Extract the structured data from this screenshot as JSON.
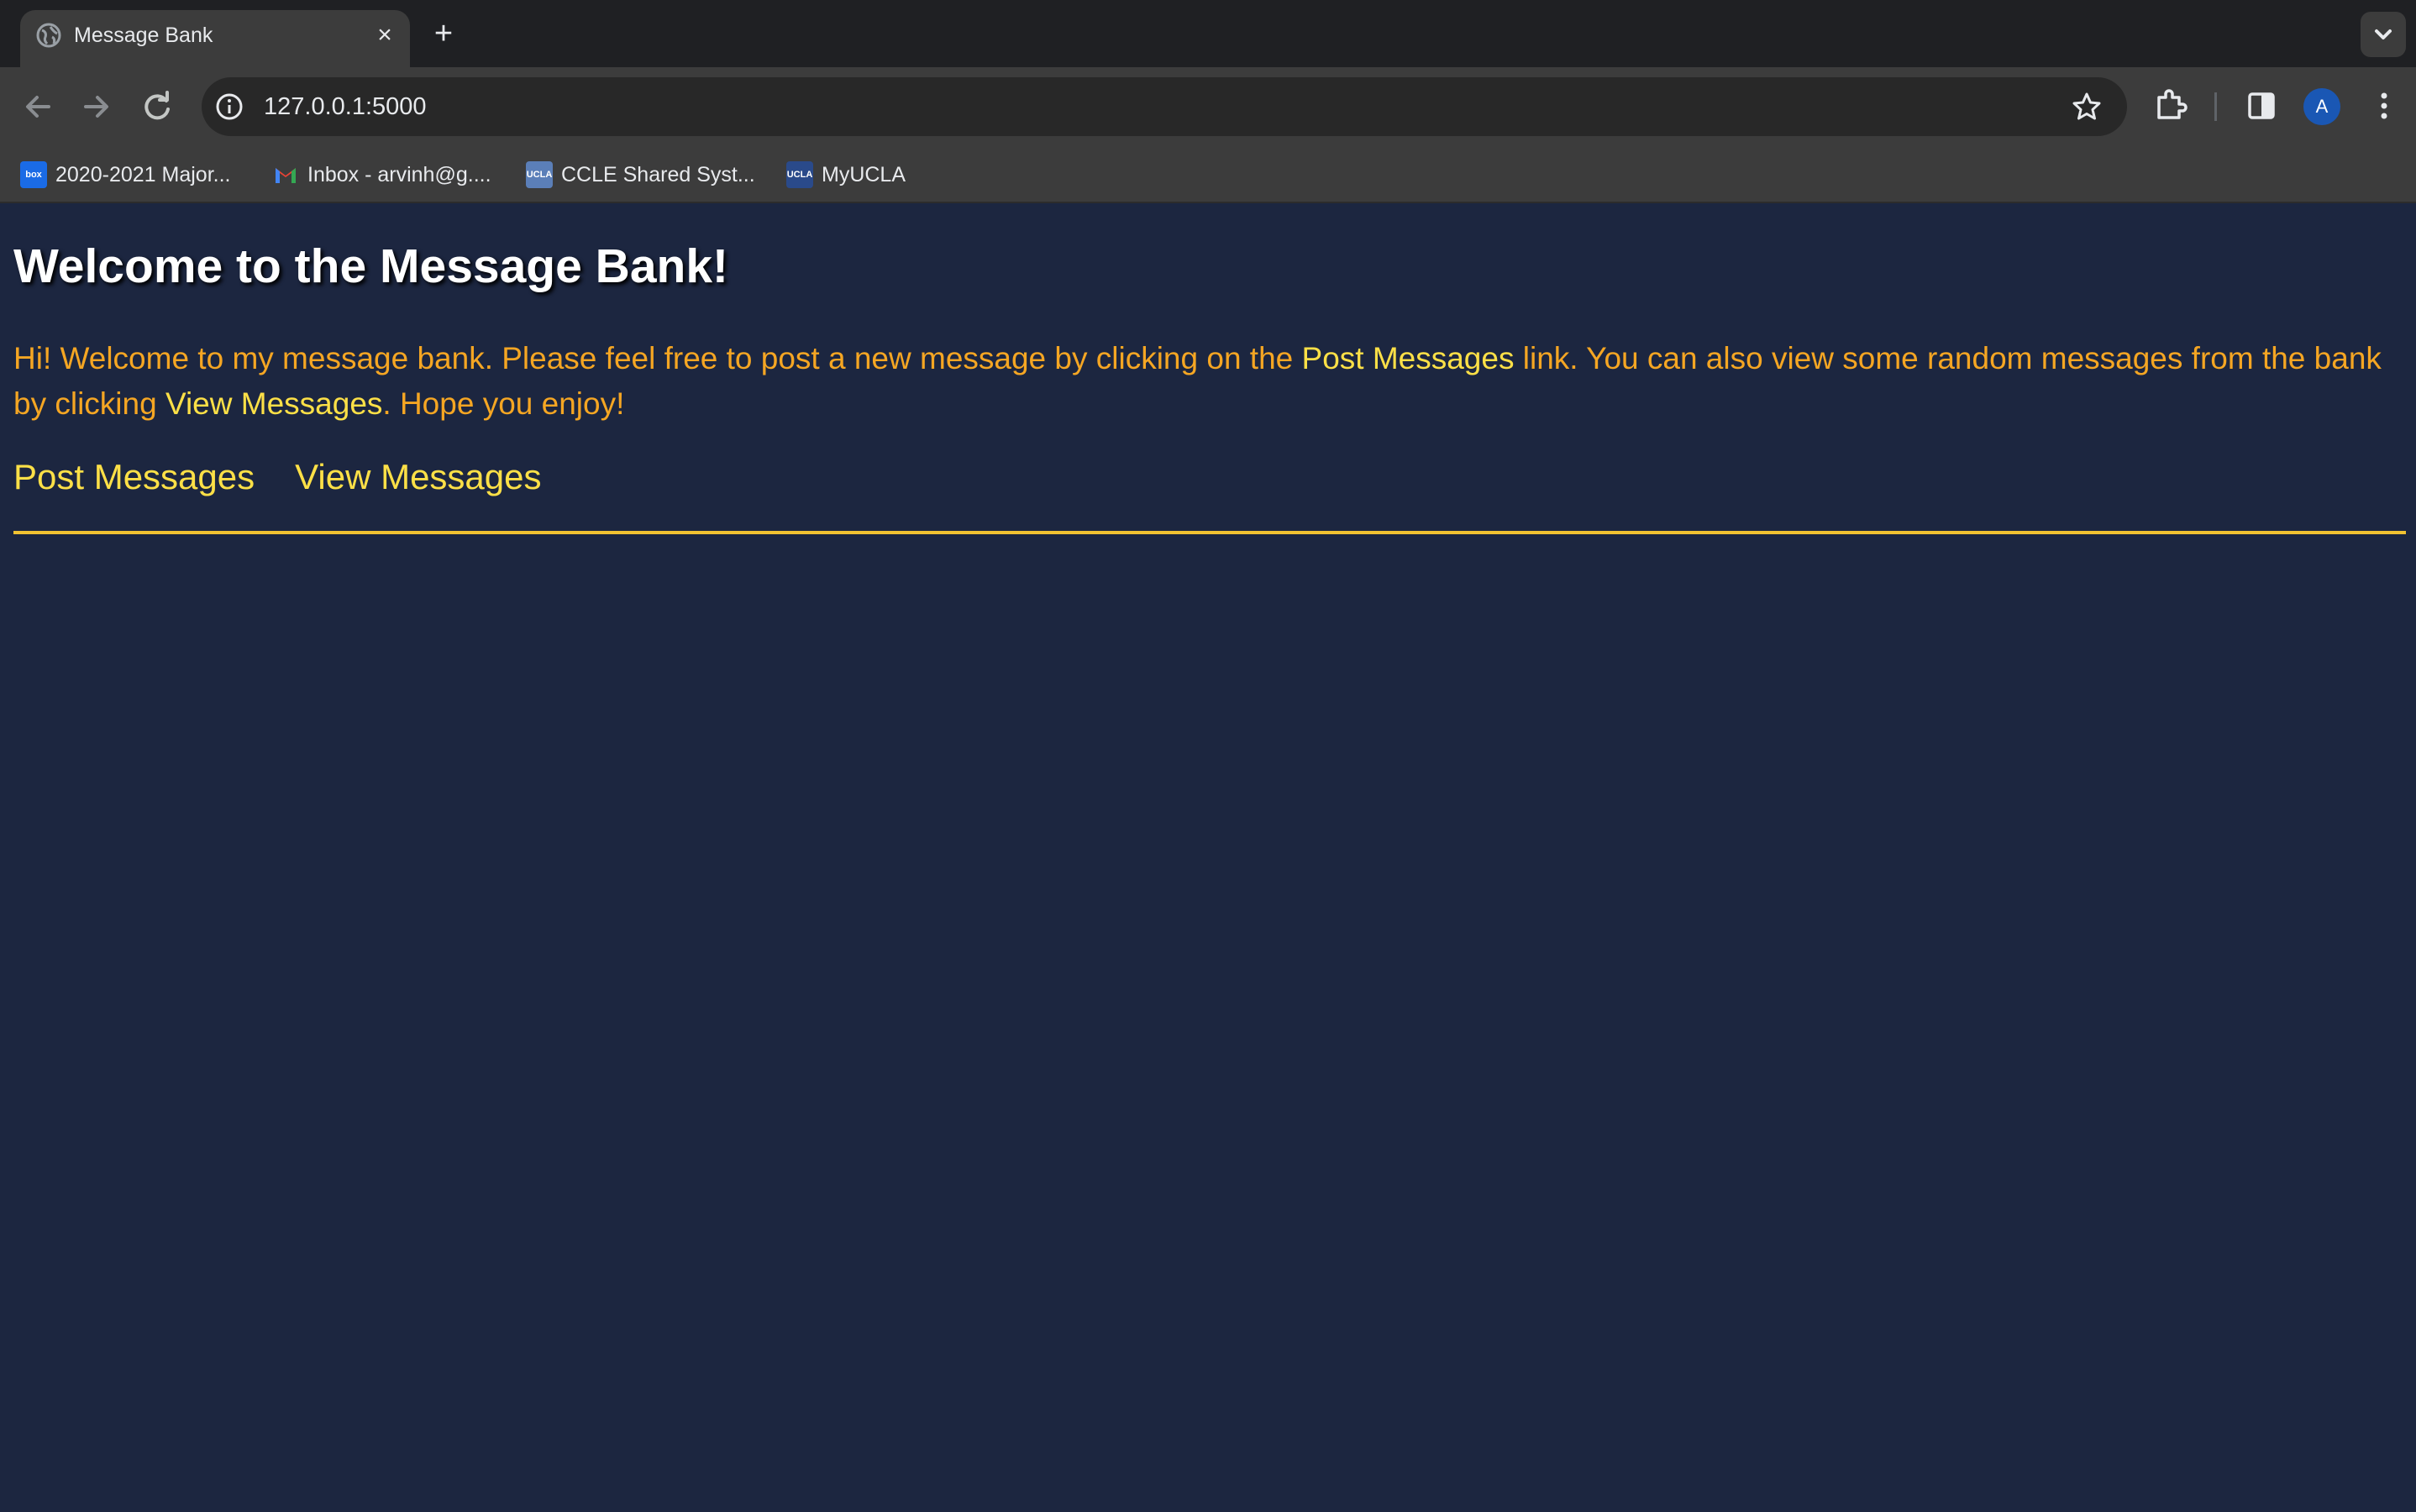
{
  "browser": {
    "tab": {
      "title": "Message Bank",
      "close_label": "×"
    },
    "new_tab_label": "+",
    "address": {
      "url": "127.0.0.1:5000"
    },
    "profile_initial": "A",
    "bookmarks": [
      {
        "label": "2020-2021 Major...",
        "icon_text": "box",
        "icon_color": "#1a6be6"
      },
      {
        "label": "Inbox - arvinh@g....",
        "icon_text": "M",
        "icon_color": "#ea4335"
      },
      {
        "label": "CCLE Shared Syst...",
        "icon_text": "UCLA",
        "icon_color": "#5b7fb8"
      },
      {
        "label": "MyUCLA",
        "icon_text": "UCLA",
        "icon_color": "#2a4a8a"
      }
    ]
  },
  "page": {
    "title": "Welcome to the Message Bank!",
    "intro": {
      "part1": "Hi! Welcome to my message bank. Please feel free to post a new message by clicking on the ",
      "link1": "Post Messages",
      "part2": " link. You can also view some random messages from the bank by clicking ",
      "link2": "View Messages",
      "part3": ". Hope you enjoy!"
    },
    "nav": {
      "post": "Post Messages",
      "view": "View Messages"
    }
  },
  "colors": {
    "page_background": "#1c2640",
    "intro_text": "#f5a623",
    "link_text": "#fde047",
    "rule": "#f1c232",
    "title_text": "#ffffff"
  }
}
